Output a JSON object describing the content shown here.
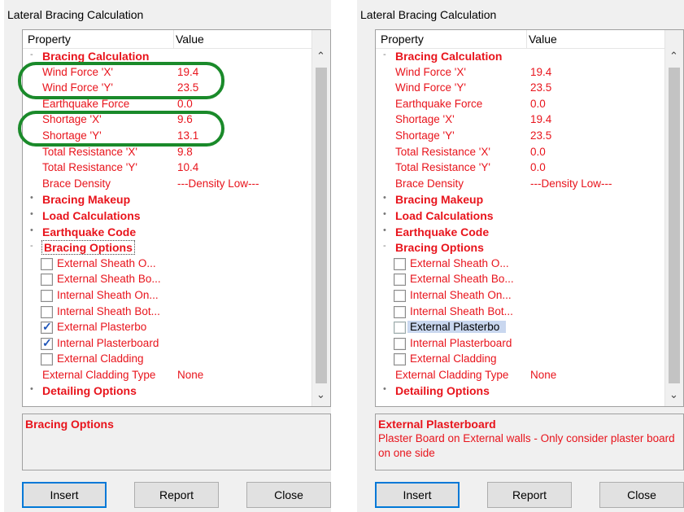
{
  "panels": [
    {
      "title": "Lateral Bracing Calculation",
      "header": {
        "property": "Property",
        "value": "Value"
      },
      "rows": [
        {
          "kind": "cat",
          "label": "Bracing Calculation",
          "expander": "-"
        },
        {
          "kind": "prop",
          "label": "Wind Force 'X'",
          "value": "19.4"
        },
        {
          "kind": "prop",
          "label": "Wind Force 'Y'",
          "value": "23.5"
        },
        {
          "kind": "prop",
          "label": "Earthquake Force",
          "value": "0.0"
        },
        {
          "kind": "prop",
          "label": "Shortage 'X'",
          "value": "9.6"
        },
        {
          "kind": "prop",
          "label": "Shortage 'Y'",
          "value": "13.1"
        },
        {
          "kind": "prop",
          "label": "Total Resistance 'X'",
          "value": "9.8"
        },
        {
          "kind": "prop",
          "label": "Total Resistance 'Y'",
          "value": "10.4"
        },
        {
          "kind": "prop",
          "label": "Brace Density",
          "value": "---Density Low---"
        },
        {
          "kind": "cat",
          "label": "Bracing Makeup",
          "expander": "+"
        },
        {
          "kind": "cat",
          "label": "Load Calculations",
          "expander": "+"
        },
        {
          "kind": "cat",
          "label": "Earthquake Code",
          "expander": "+"
        },
        {
          "kind": "cat",
          "label": "Bracing Options",
          "expander": "-",
          "dotted": true
        },
        {
          "kind": "chk",
          "label": "External Sheath O...",
          "checked": false
        },
        {
          "kind": "chk",
          "label": "External Sheath Bo...",
          "checked": false
        },
        {
          "kind": "chk",
          "label": "Internal Sheath On...",
          "checked": false
        },
        {
          "kind": "chk",
          "label": "Internal Sheath Bot...",
          "checked": false
        },
        {
          "kind": "chk",
          "label": "External Plasterbo",
          "checked": true
        },
        {
          "kind": "chk",
          "label": "Internal Plasterboard",
          "checked": true
        },
        {
          "kind": "chk",
          "label": "External Cladding",
          "checked": false
        },
        {
          "kind": "prop",
          "label": "External Cladding Type",
          "value": "None"
        },
        {
          "kind": "cat",
          "label": "Detailing Options",
          "expander": "+"
        }
      ],
      "description": {
        "title": "Bracing Options",
        "body": ""
      },
      "buttons": {
        "insert": "Insert",
        "report": "Report",
        "close": "Close"
      }
    },
    {
      "title": "Lateral Bracing Calculation",
      "header": {
        "property": "Property",
        "value": "Value"
      },
      "rows": [
        {
          "kind": "cat",
          "label": "Bracing Calculation",
          "expander": "-"
        },
        {
          "kind": "prop",
          "label": "Wind Force 'X'",
          "value": "19.4"
        },
        {
          "kind": "prop",
          "label": "Wind Force 'Y'",
          "value": "23.5"
        },
        {
          "kind": "prop",
          "label": "Earthquake Force",
          "value": "0.0"
        },
        {
          "kind": "prop",
          "label": "Shortage 'X'",
          "value": "19.4"
        },
        {
          "kind": "prop",
          "label": "Shortage 'Y'",
          "value": "23.5"
        },
        {
          "kind": "prop",
          "label": "Total Resistance 'X'",
          "value": "0.0"
        },
        {
          "kind": "prop",
          "label": "Total Resistance 'Y'",
          "value": "0.0"
        },
        {
          "kind": "prop",
          "label": "Brace Density",
          "value": "---Density Low---"
        },
        {
          "kind": "cat",
          "label": "Bracing Makeup",
          "expander": "+"
        },
        {
          "kind": "cat",
          "label": "Load Calculations",
          "expander": "+"
        },
        {
          "kind": "cat",
          "label": "Earthquake Code",
          "expander": "+"
        },
        {
          "kind": "cat",
          "label": "Bracing Options",
          "expander": "-"
        },
        {
          "kind": "chk",
          "label": "External Sheath O...",
          "checked": false
        },
        {
          "kind": "chk",
          "label": "External Sheath Bo...",
          "checked": false
        },
        {
          "kind": "chk",
          "label": "Internal Sheath On...",
          "checked": false
        },
        {
          "kind": "chk",
          "label": "Internal Sheath Bot...",
          "checked": false
        },
        {
          "kind": "chk",
          "label": "External Plasterbo",
          "checked": false,
          "selected": true
        },
        {
          "kind": "chk",
          "label": "Internal Plasterboard",
          "checked": false
        },
        {
          "kind": "chk",
          "label": "External Cladding",
          "checked": false
        },
        {
          "kind": "prop",
          "label": "External Cladding Type",
          "value": "None"
        },
        {
          "kind": "cat",
          "label": "Detailing Options",
          "expander": "+"
        }
      ],
      "description": {
        "title": "External Plasterboard",
        "body": "Plaster Board on External walls - Only consider plaster board on one side"
      },
      "buttons": {
        "insert": "Insert",
        "report": "Report",
        "close": "Close"
      }
    }
  ],
  "colors": {
    "property_text": "#e8141c",
    "annotation_oval": "#1a8a2a",
    "selection": "#c9d7ef"
  },
  "icons": {
    "scroll_up": "chevron-up-icon",
    "scroll_down": "chevron-down-icon",
    "expander": "expander-dot-icon"
  }
}
